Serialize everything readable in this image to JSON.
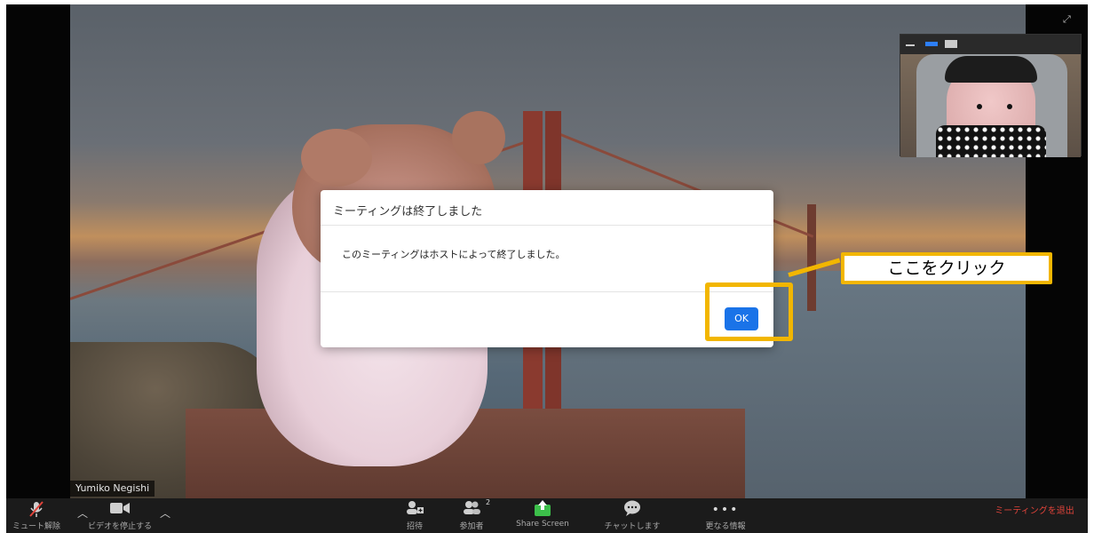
{
  "dialog": {
    "title": "ミーティングは終了しました",
    "message": "このミーティングはホストによって終了しました。",
    "ok_label": "OK"
  },
  "callout": {
    "label": "ここをクリック"
  },
  "video": {
    "participant_name": "Yumiko Negishi"
  },
  "toolbar": {
    "mute_label": "ミュート解除",
    "video_label": "ビデオを停止する",
    "invite_label": "招待",
    "participants_label": "参加者",
    "participants_count": "2",
    "share_label": "Share Screen",
    "chat_label": "チャットします",
    "more_label": "更なる情報",
    "end_label": "ミーティングを退出"
  },
  "colors": {
    "accent": "#1a73e8",
    "callout": "#f2b600",
    "share_green": "#3cbf4a",
    "end_red": "#e0433a"
  },
  "icons": {
    "mic": "microphone-muted-icon",
    "video": "video-camera-icon",
    "invite": "invite-user-icon",
    "participants": "participants-icon",
    "share": "share-screen-icon",
    "chat": "chat-bubble-icon",
    "more": "more-dots-icon",
    "fullscreen": "fullscreen-icon"
  }
}
